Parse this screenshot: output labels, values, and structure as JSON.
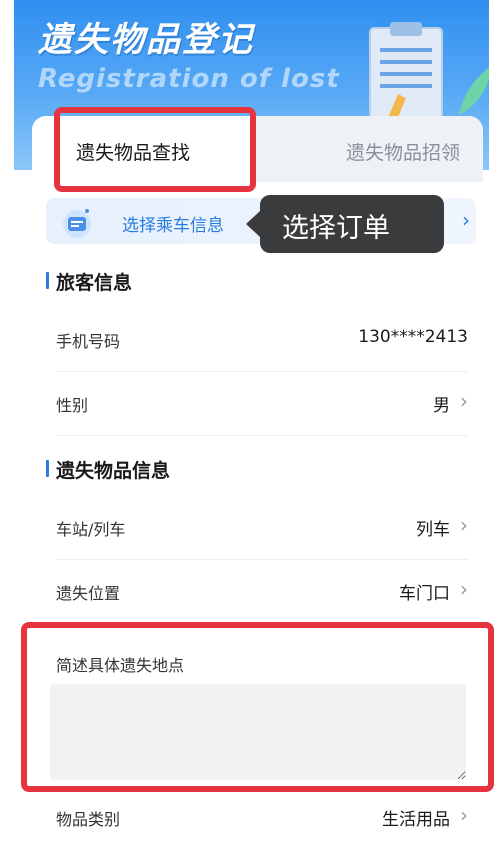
{
  "header": {
    "title": "遗失物品登记",
    "subtitle": "Registration of lost"
  },
  "tabs": [
    {
      "label": "遗失物品查找",
      "active": true
    },
    {
      "label": "遗失物品招领",
      "active": false
    }
  ],
  "select_trip": {
    "label": "选择乘车信息",
    "icon": "ticket-icon"
  },
  "tooltip": {
    "text": "选择订单"
  },
  "passenger_section": {
    "title": "旅客信息",
    "rows": [
      {
        "key": "手机号码",
        "value": "130****2413"
      },
      {
        "key": "性别",
        "value": "男"
      }
    ]
  },
  "lost_section": {
    "title": "遗失物品信息",
    "rows": [
      {
        "key": "车站/列车",
        "value": "列车"
      },
      {
        "key": "遗失位置",
        "value": "车门口"
      }
    ],
    "description_label": "简述具体遗失地点",
    "description_value": "",
    "category": {
      "key": "物品类别",
      "value": "生活用品"
    }
  },
  "colors": {
    "accent": "#2a7be0",
    "highlight": "#e5343f",
    "tooltip_bg": "#3a3b3d"
  }
}
